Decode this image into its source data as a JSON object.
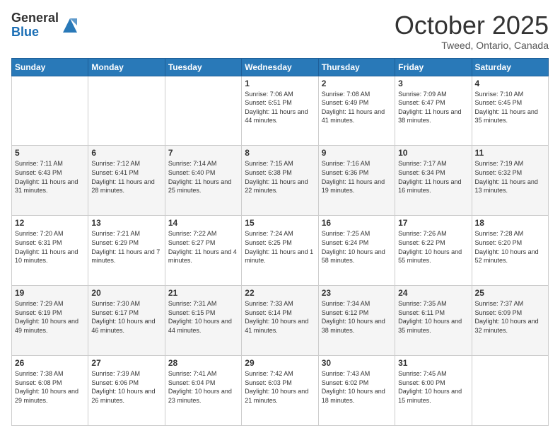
{
  "header": {
    "logo_general": "General",
    "logo_blue": "Blue",
    "month": "October 2025",
    "location": "Tweed, Ontario, Canada"
  },
  "weekdays": [
    "Sunday",
    "Monday",
    "Tuesday",
    "Wednesday",
    "Thursday",
    "Friday",
    "Saturday"
  ],
  "weeks": [
    [
      {
        "day": "",
        "info": ""
      },
      {
        "day": "",
        "info": ""
      },
      {
        "day": "",
        "info": ""
      },
      {
        "day": "1",
        "info": "Sunrise: 7:06 AM\nSunset: 6:51 PM\nDaylight: 11 hours\nand 44 minutes."
      },
      {
        "day": "2",
        "info": "Sunrise: 7:08 AM\nSunset: 6:49 PM\nDaylight: 11 hours\nand 41 minutes."
      },
      {
        "day": "3",
        "info": "Sunrise: 7:09 AM\nSunset: 6:47 PM\nDaylight: 11 hours\nand 38 minutes."
      },
      {
        "day": "4",
        "info": "Sunrise: 7:10 AM\nSunset: 6:45 PM\nDaylight: 11 hours\nand 35 minutes."
      }
    ],
    [
      {
        "day": "5",
        "info": "Sunrise: 7:11 AM\nSunset: 6:43 PM\nDaylight: 11 hours\nand 31 minutes."
      },
      {
        "day": "6",
        "info": "Sunrise: 7:12 AM\nSunset: 6:41 PM\nDaylight: 11 hours\nand 28 minutes."
      },
      {
        "day": "7",
        "info": "Sunrise: 7:14 AM\nSunset: 6:40 PM\nDaylight: 11 hours\nand 25 minutes."
      },
      {
        "day": "8",
        "info": "Sunrise: 7:15 AM\nSunset: 6:38 PM\nDaylight: 11 hours\nand 22 minutes."
      },
      {
        "day": "9",
        "info": "Sunrise: 7:16 AM\nSunset: 6:36 PM\nDaylight: 11 hours\nand 19 minutes."
      },
      {
        "day": "10",
        "info": "Sunrise: 7:17 AM\nSunset: 6:34 PM\nDaylight: 11 hours\nand 16 minutes."
      },
      {
        "day": "11",
        "info": "Sunrise: 7:19 AM\nSunset: 6:32 PM\nDaylight: 11 hours\nand 13 minutes."
      }
    ],
    [
      {
        "day": "12",
        "info": "Sunrise: 7:20 AM\nSunset: 6:31 PM\nDaylight: 11 hours\nand 10 minutes."
      },
      {
        "day": "13",
        "info": "Sunrise: 7:21 AM\nSunset: 6:29 PM\nDaylight: 11 hours\nand 7 minutes."
      },
      {
        "day": "14",
        "info": "Sunrise: 7:22 AM\nSunset: 6:27 PM\nDaylight: 11 hours\nand 4 minutes."
      },
      {
        "day": "15",
        "info": "Sunrise: 7:24 AM\nSunset: 6:25 PM\nDaylight: 11 hours\nand 1 minute."
      },
      {
        "day": "16",
        "info": "Sunrise: 7:25 AM\nSunset: 6:24 PM\nDaylight: 10 hours\nand 58 minutes."
      },
      {
        "day": "17",
        "info": "Sunrise: 7:26 AM\nSunset: 6:22 PM\nDaylight: 10 hours\nand 55 minutes."
      },
      {
        "day": "18",
        "info": "Sunrise: 7:28 AM\nSunset: 6:20 PM\nDaylight: 10 hours\nand 52 minutes."
      }
    ],
    [
      {
        "day": "19",
        "info": "Sunrise: 7:29 AM\nSunset: 6:19 PM\nDaylight: 10 hours\nand 49 minutes."
      },
      {
        "day": "20",
        "info": "Sunrise: 7:30 AM\nSunset: 6:17 PM\nDaylight: 10 hours\nand 46 minutes."
      },
      {
        "day": "21",
        "info": "Sunrise: 7:31 AM\nSunset: 6:15 PM\nDaylight: 10 hours\nand 44 minutes."
      },
      {
        "day": "22",
        "info": "Sunrise: 7:33 AM\nSunset: 6:14 PM\nDaylight: 10 hours\nand 41 minutes."
      },
      {
        "day": "23",
        "info": "Sunrise: 7:34 AM\nSunset: 6:12 PM\nDaylight: 10 hours\nand 38 minutes."
      },
      {
        "day": "24",
        "info": "Sunrise: 7:35 AM\nSunset: 6:11 PM\nDaylight: 10 hours\nand 35 minutes."
      },
      {
        "day": "25",
        "info": "Sunrise: 7:37 AM\nSunset: 6:09 PM\nDaylight: 10 hours\nand 32 minutes."
      }
    ],
    [
      {
        "day": "26",
        "info": "Sunrise: 7:38 AM\nSunset: 6:08 PM\nDaylight: 10 hours\nand 29 minutes."
      },
      {
        "day": "27",
        "info": "Sunrise: 7:39 AM\nSunset: 6:06 PM\nDaylight: 10 hours\nand 26 minutes."
      },
      {
        "day": "28",
        "info": "Sunrise: 7:41 AM\nSunset: 6:04 PM\nDaylight: 10 hours\nand 23 minutes."
      },
      {
        "day": "29",
        "info": "Sunrise: 7:42 AM\nSunset: 6:03 PM\nDaylight: 10 hours\nand 21 minutes."
      },
      {
        "day": "30",
        "info": "Sunrise: 7:43 AM\nSunset: 6:02 PM\nDaylight: 10 hours\nand 18 minutes."
      },
      {
        "day": "31",
        "info": "Sunrise: 7:45 AM\nSunset: 6:00 PM\nDaylight: 10 hours\nand 15 minutes."
      },
      {
        "day": "",
        "info": ""
      }
    ]
  ]
}
